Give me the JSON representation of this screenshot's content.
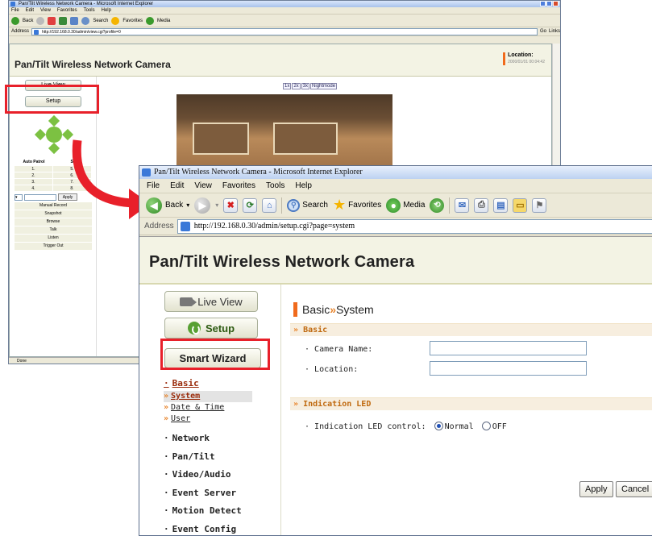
{
  "back_window": {
    "title": "Pan/Tilt Wireless Network Camera - Microsoft Internet Explorer",
    "menu": [
      "File",
      "Edit",
      "View",
      "Favorites",
      "Tools",
      "Help"
    ],
    "toolbar": {
      "back": "Back",
      "search": "Search",
      "favorites": "Favorites",
      "media": "Media"
    },
    "address_label": "Address",
    "url": "http://192.168.0.30/admin/view.cgi?profile=0",
    "go": "Go",
    "links": "Links",
    "page_title": "Pan/Tilt Wireless Network Camera",
    "location_label": "Location:",
    "location_date": "2000/01/01 00:04:42",
    "live_view": "Live View",
    "setup": "Setup",
    "zoom": [
      "1x",
      "2x",
      "3x",
      "Nightmode"
    ],
    "patrol_headers": [
      "Auto Patrol",
      "St"
    ],
    "patrol_rows": [
      [
        "1.",
        "5."
      ],
      [
        "2.",
        "6."
      ],
      [
        "3.",
        "7."
      ],
      [
        "4.",
        "8."
      ]
    ],
    "apply": "Apply",
    "actions": [
      "Manual Record",
      "Snapshot",
      "Browse",
      "Talk",
      "Listen",
      "Trigger Out"
    ],
    "status": "Done"
  },
  "front_window": {
    "title": "Pan/Tilt Wireless Network Camera - Microsoft Internet Explorer",
    "menu": [
      "File",
      "Edit",
      "View",
      "Favorites",
      "Tools",
      "Help"
    ],
    "toolbar": {
      "back": "Back",
      "search": "Search",
      "favorites": "Favorites",
      "media": "Media"
    },
    "address_label": "Address",
    "url": "http://192.168.0.30/admin/setup.cgi?page=system",
    "page_title": "Pan/Tilt Wireless Network Camera",
    "live_view": "Live View",
    "setup": "Setup",
    "smart_wizard": "Smart Wizard",
    "menu_items": {
      "basic": "Basic",
      "sub": [
        "System",
        "Date & Time",
        "User"
      ],
      "rest": [
        "Network",
        "Pan/Tilt",
        "Video/Audio",
        "Event Server",
        "Motion Detect",
        "Event Config"
      ]
    },
    "main_title_a": "Basic",
    "main_title_sep": "»",
    "main_title_b": "System",
    "section_basic": "Basic",
    "camera_name_label": "Camera Name:",
    "camera_name_value": "",
    "location_label": "Location:",
    "location_value": "",
    "section_led": "Indication LED",
    "led_label": "Indication LED control:",
    "led_options": [
      "Normal",
      "OFF"
    ],
    "led_selected": "Normal",
    "apply": "Apply",
    "cancel": "Cancel"
  },
  "colors": {
    "annotation": "#e8202a",
    "accent": "#f06a1c",
    "section": "#c06a10",
    "green": "#58a033"
  }
}
